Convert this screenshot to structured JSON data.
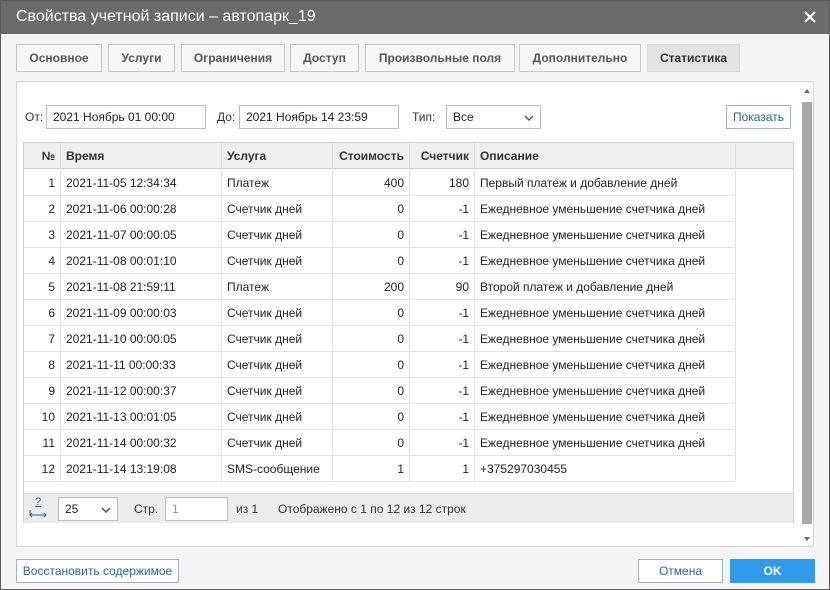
{
  "window": {
    "title": "Свойства учетной записи – автопарк_19"
  },
  "tabs": [
    {
      "label": "Основное"
    },
    {
      "label": "Услуги"
    },
    {
      "label": "Ограничения"
    },
    {
      "label": "Доступ"
    },
    {
      "label": "Произвольные поля"
    },
    {
      "label": "Дополнительно"
    },
    {
      "label": "Статистика",
      "active": true
    }
  ],
  "filters": {
    "from_label": "От:",
    "from_value": "2021 Ноябрь 01 00:00",
    "to_label": "До:",
    "to_value": "2021 Ноябрь 14 23:59",
    "type_label": "Тип:",
    "type_value": "Все",
    "show_button": "Показать"
  },
  "table": {
    "columns": [
      "№",
      "Время",
      "Услуга",
      "Стоимость",
      "Счетчик",
      "Описание"
    ],
    "rows": [
      [
        "1",
        "2021-11-05 12:34:34",
        "Платеж",
        "400",
        "180",
        "Первый платеж и добавление дней"
      ],
      [
        "2",
        "2021-11-06 00:00:28",
        "Счетчик дней",
        "0",
        "-1",
        "Ежедневное уменьшение счетчика дней"
      ],
      [
        "3",
        "2021-11-07 00:00:05",
        "Счетчик дней",
        "0",
        "-1",
        "Ежедневное уменьшение счетчика дней"
      ],
      [
        "4",
        "2021-11-08 00:01:10",
        "Счетчик дней",
        "0",
        "-1",
        "Ежедневное уменьшение счетчика дней"
      ],
      [
        "5",
        "2021-11-08 21:59:11",
        "Платеж",
        "200",
        "90",
        "Второй платеж и добавление дней"
      ],
      [
        "6",
        "2021-11-09 00:00:03",
        "Счетчик дней",
        "0",
        "-1",
        "Ежедневное уменьшение счетчика дней"
      ],
      [
        "7",
        "2021-11-10 00:00:05",
        "Счетчик дней",
        "0",
        "-1",
        "Ежедневное уменьшение счетчика дней"
      ],
      [
        "8",
        "2021-11-11 00:00:33",
        "Счетчик дней",
        "0",
        "-1",
        "Ежедневное уменьшение счетчика дней"
      ],
      [
        "9",
        "2021-11-12 00:00:37",
        "Счетчик дней",
        "0",
        "-1",
        "Ежедневное уменьшение счетчика дней"
      ],
      [
        "10",
        "2021-11-13 00:01:05",
        "Счетчик дней",
        "0",
        "-1",
        "Ежедневное уменьшение счетчика дней"
      ],
      [
        "11",
        "2021-11-14 00:00:32",
        "Счетчик дней",
        "0",
        "-1",
        "Ежедневное уменьшение счетчика дней"
      ],
      [
        "12",
        "2021-11-14 13:19:08",
        "SMS-сообщение",
        "1",
        "1",
        "+375297030455"
      ]
    ]
  },
  "pager": {
    "help_icon_text": "?",
    "page_size": "25",
    "page_label": "Стр.",
    "page_value": "1",
    "of_label": "из 1",
    "summary": "Отображено с 1 по 12 из 12 строк"
  },
  "footer": {
    "restore_button": "Восстановить содержимое",
    "cancel_button": "Отмена",
    "ok_button": "OK"
  },
  "colors": {
    "titlebar": "#6b6b6b",
    "ok_button": "#2f9bea",
    "link_text": "#2a6496"
  }
}
